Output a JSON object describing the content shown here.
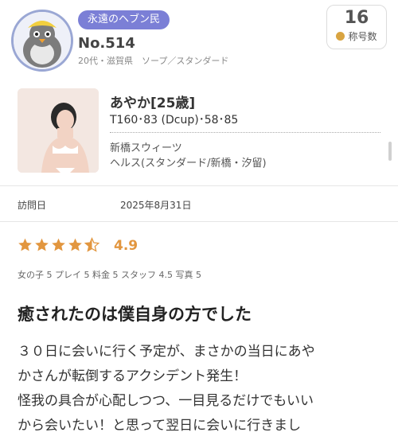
{
  "profile": {
    "badge": "永遠のヘブン民",
    "member_no": "No.514",
    "meta": "20代・滋賀県　ソープ／スタンダード",
    "title_count": "16",
    "title_count_label": "称号数"
  },
  "girl": {
    "name": "あやか[25歳]",
    "size": "T160･83 (Dcup)･58･85",
    "shop": "新橋スウィーツ",
    "genre": "ヘルス(スタンダード/新橋・汐留)"
  },
  "visit": {
    "label": "訪問日",
    "date": "2025年8月31日"
  },
  "rating": {
    "score": "4.9",
    "stars": 4.9,
    "breakdown": "女の子 5  プレイ 5  料金 5  スタッフ 4.5  写真 5"
  },
  "review": {
    "title": "癒されたのは僕自身の方でした",
    "lines": [
      "３０日に会いに行く予定が、まさかの当日にあや",
      "かさんが転倒するアクシデント発生！",
      "怪我の具合が心配しつつ、一目見るだけでもいい",
      "から会いたい！と思って翌日に会いに行きまし"
    ]
  },
  "colors": {
    "badge": "#7b7fd6",
    "star": "#e2963f",
    "coin": "#d9a441"
  }
}
